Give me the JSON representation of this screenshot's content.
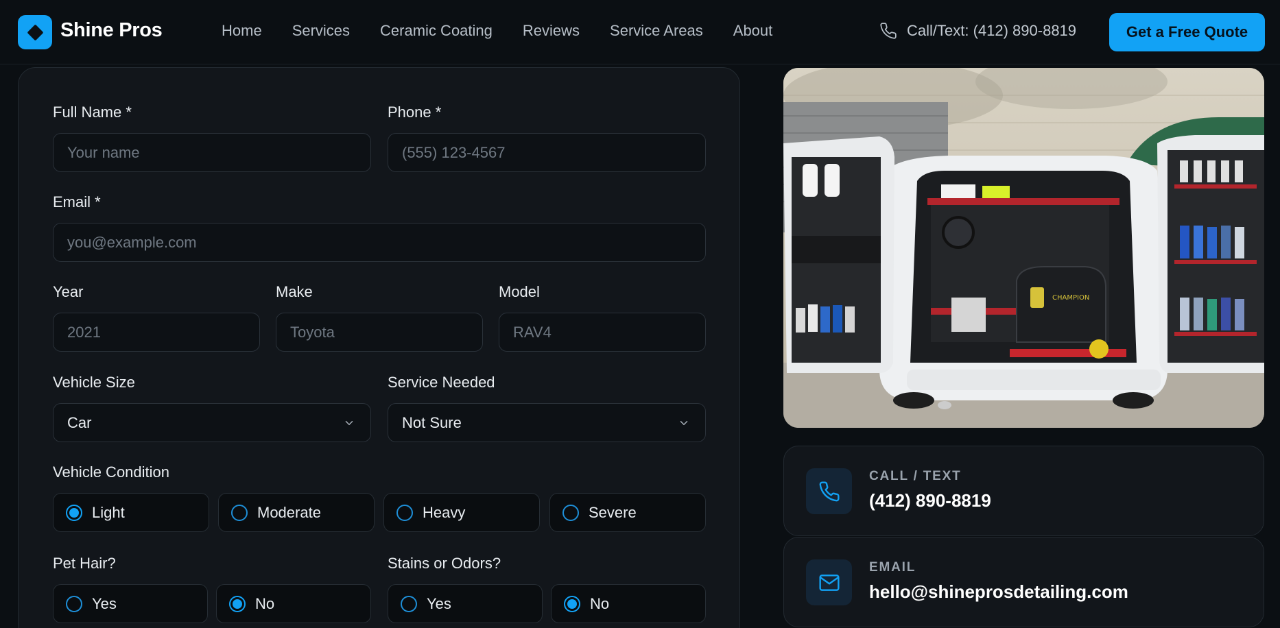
{
  "brand": {
    "name": "Shine Pros",
    "accent": "#12a2f5"
  },
  "nav": {
    "links": [
      "Home",
      "Services",
      "Ceramic Coating",
      "Reviews",
      "Service Areas",
      "About"
    ],
    "phone_text": "Call/Text: (412) 890-8819",
    "cta": "Get a Free Quote"
  },
  "form": {
    "full_name": {
      "label": "Full Name *",
      "placeholder": "Your name"
    },
    "phone": {
      "label": "Phone *",
      "placeholder": "(555) 123-4567"
    },
    "email": {
      "label": "Email *",
      "placeholder": "you@example.com"
    },
    "year": {
      "label": "Year",
      "placeholder": "2021"
    },
    "make": {
      "label": "Make",
      "placeholder": "Toyota"
    },
    "model": {
      "label": "Model",
      "placeholder": "RAV4"
    },
    "vehicle_size": {
      "label": "Vehicle Size",
      "value": "Car"
    },
    "service_needed": {
      "label": "Service Needed",
      "value": "Not Sure"
    },
    "vehicle_condition": {
      "label": "Vehicle Condition",
      "options": [
        "Light",
        "Moderate",
        "Heavy",
        "Severe"
      ],
      "selected": "Light"
    },
    "pet_hair": {
      "label": "Pet Hair?",
      "options": [
        "Yes",
        "No"
      ],
      "selected": "No"
    },
    "stains_odors": {
      "label": "Stains or Odors?",
      "options": [
        "Yes",
        "No"
      ],
      "selected": "No"
    }
  },
  "contact": {
    "call": {
      "kicker": "CALL / TEXT",
      "value": "(412) 890-8819"
    },
    "email": {
      "kicker": "EMAIL",
      "value": "hello@shineprosdetailing.com"
    }
  }
}
